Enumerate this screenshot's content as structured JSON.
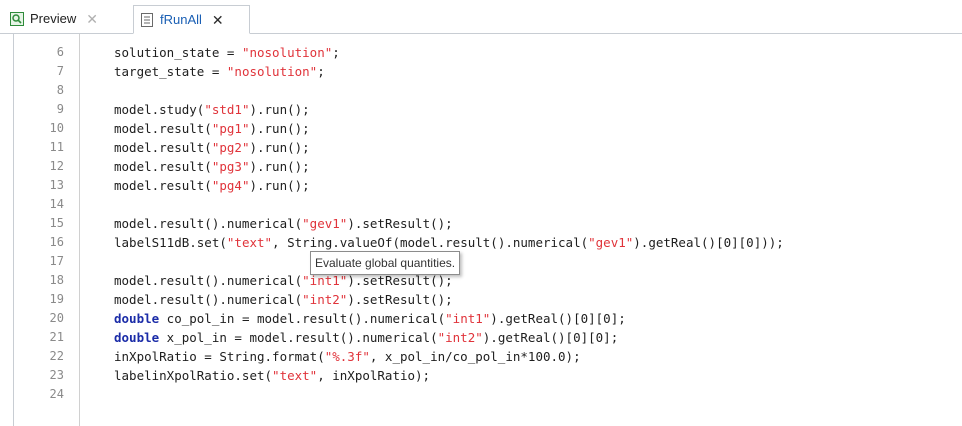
{
  "tabs": [
    {
      "label": "Preview",
      "icon": "preview-icon",
      "active": false
    },
    {
      "label": "fRunAll",
      "icon": "method-icon",
      "active": true
    }
  ],
  "tooltip": "Evaluate global quantities.",
  "colors": {
    "string": "#e0333a",
    "keyword": "#1b2ca8",
    "tab_active_text": "#1a5fb4"
  },
  "lines": [
    {
      "n": "6",
      "segs": [
        {
          "t": "solution_state = ",
          "c": ""
        },
        {
          "t": "\"nosolution\"",
          "c": "str"
        },
        {
          "t": ";",
          "c": ""
        }
      ]
    },
    {
      "n": "7",
      "segs": [
        {
          "t": "target_state = ",
          "c": ""
        },
        {
          "t": "\"nosolution\"",
          "c": "str"
        },
        {
          "t": ";",
          "c": ""
        }
      ]
    },
    {
      "n": "8",
      "segs": []
    },
    {
      "n": "9",
      "segs": [
        {
          "t": "model.study(",
          "c": ""
        },
        {
          "t": "\"std1\"",
          "c": "str"
        },
        {
          "t": ").run();",
          "c": ""
        }
      ]
    },
    {
      "n": "10",
      "segs": [
        {
          "t": "model.result(",
          "c": ""
        },
        {
          "t": "\"pg1\"",
          "c": "str"
        },
        {
          "t": ").run();",
          "c": ""
        }
      ]
    },
    {
      "n": "11",
      "segs": [
        {
          "t": "model.result(",
          "c": ""
        },
        {
          "t": "\"pg2\"",
          "c": "str"
        },
        {
          "t": ").run();",
          "c": ""
        }
      ]
    },
    {
      "n": "12",
      "segs": [
        {
          "t": "model.result(",
          "c": ""
        },
        {
          "t": "\"pg3\"",
          "c": "str"
        },
        {
          "t": ").run();",
          "c": ""
        }
      ]
    },
    {
      "n": "13",
      "segs": [
        {
          "t": "model.result(",
          "c": ""
        },
        {
          "t": "\"pg4\"",
          "c": "str"
        },
        {
          "t": ").run();",
          "c": ""
        }
      ]
    },
    {
      "n": "14",
      "segs": []
    },
    {
      "n": "15",
      "segs": [
        {
          "t": "model.result().numerical(",
          "c": ""
        },
        {
          "t": "\"gev1\"",
          "c": "str"
        },
        {
          "t": ").setResult();",
          "c": ""
        }
      ]
    },
    {
      "n": "16",
      "segs": [
        {
          "t": "labelS11dB.set(",
          "c": ""
        },
        {
          "t": "\"text\"",
          "c": "str"
        },
        {
          "t": ", String.valueOf(model.result().numerical(",
          "c": ""
        },
        {
          "t": "\"gev1\"",
          "c": "str"
        },
        {
          "t": ").getReal()[0][0]));",
          "c": ""
        }
      ]
    },
    {
      "n": "17",
      "segs": []
    },
    {
      "n": "18",
      "segs": [
        {
          "t": "model.result().numerical(",
          "c": ""
        },
        {
          "t": "\"int1\"",
          "c": "str"
        },
        {
          "t": ").setResult();",
          "c": ""
        }
      ]
    },
    {
      "n": "19",
      "segs": [
        {
          "t": "model.result().numerical(",
          "c": ""
        },
        {
          "t": "\"int2\"",
          "c": "str"
        },
        {
          "t": ").setResult();",
          "c": ""
        }
      ]
    },
    {
      "n": "20",
      "segs": [
        {
          "t": "double",
          "c": "kw"
        },
        {
          "t": " co_pol_in = model.result().numerical(",
          "c": ""
        },
        {
          "t": "\"int1\"",
          "c": "str"
        },
        {
          "t": ").getReal()[0][0];",
          "c": ""
        }
      ]
    },
    {
      "n": "21",
      "segs": [
        {
          "t": "double",
          "c": "kw"
        },
        {
          "t": " x_pol_in = model.result().numerical(",
          "c": ""
        },
        {
          "t": "\"int2\"",
          "c": "str"
        },
        {
          "t": ").getReal()[0][0];",
          "c": ""
        }
      ]
    },
    {
      "n": "22",
      "segs": [
        {
          "t": "inXpolRatio = String.format(",
          "c": ""
        },
        {
          "t": "\"%.3f\"",
          "c": "str"
        },
        {
          "t": ", x_pol_in/co_pol_in*100.0);",
          "c": ""
        }
      ]
    },
    {
      "n": "23",
      "segs": [
        {
          "t": "labelinXpolRatio.set(",
          "c": ""
        },
        {
          "t": "\"text\"",
          "c": "str"
        },
        {
          "t": ", inXpolRatio);",
          "c": ""
        }
      ]
    },
    {
      "n": "24",
      "segs": []
    }
  ]
}
